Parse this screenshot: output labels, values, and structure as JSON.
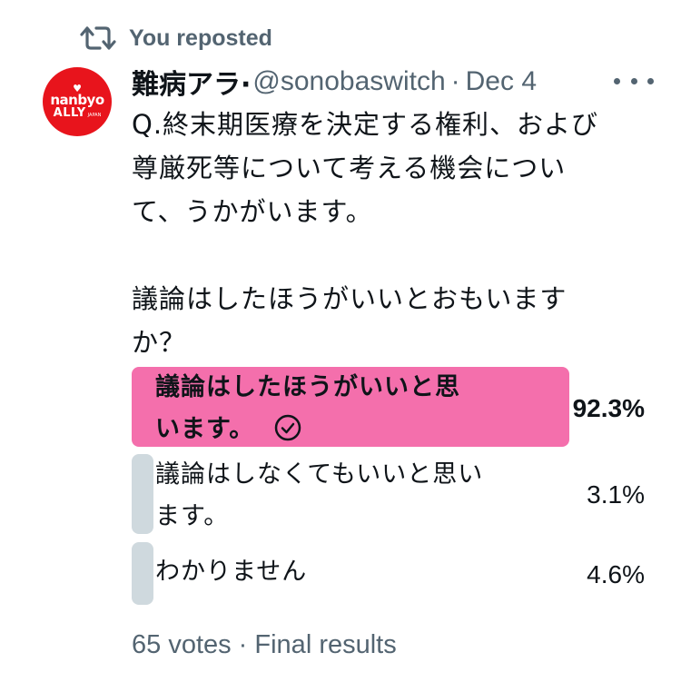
{
  "repost": {
    "label": "You reposted",
    "icon": "repost-icon"
  },
  "author": {
    "avatar": {
      "logo_top": "nanbyo",
      "logo_bottom": "ALLY",
      "logo_small": "JAPAN",
      "bg_color": "#e8141c"
    },
    "display_name": "難病アラ·",
    "handle": "@sonobaswitch",
    "separator": "·",
    "date": "Dec 4"
  },
  "tweet": {
    "lines": [
      "Q.終末期医療を決定する権利、および",
      "尊厳死等について考える機会につい",
      "て、うかがいます。",
      "",
      "議論はしたほうがいいとおもいます",
      "か？"
    ]
  },
  "poll": {
    "options": [
      {
        "line1": "議論はしたほうがいいと思",
        "line2": "います。",
        "percent_text": "92.3%",
        "percent": 92.3,
        "selected": true,
        "bar_color": "#f46fac"
      },
      {
        "line1": "議論はしなくてもいいと思い",
        "line2": "ます。",
        "percent_text": "3.1%",
        "percent": 3.1,
        "selected": false,
        "bar_color": "#cfd9de"
      },
      {
        "line1": "わかりません",
        "line2": "",
        "percent_text": "4.6%",
        "percent": 4.6,
        "selected": false,
        "bar_color": "#cfd9de"
      }
    ],
    "footer": "65 votes · Final results"
  },
  "colors": {
    "text_primary": "#0f1419",
    "text_secondary": "#536471",
    "winner_bar": "#f46fac",
    "loser_bar": "#cfd9de"
  }
}
